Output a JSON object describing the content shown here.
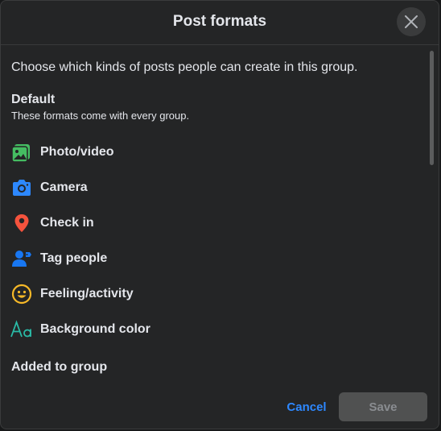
{
  "dialog": {
    "title": "Post formats",
    "intro": "Choose which kinds of posts people can create in this group.",
    "default_section": {
      "title": "Default",
      "subtitle": "These formats come with every group.",
      "formats": [
        {
          "label": "Photo/video",
          "icon": "photo-video-icon",
          "color": "#45bd62"
        },
        {
          "label": "Camera",
          "icon": "camera-icon",
          "color": "#2d88ff"
        },
        {
          "label": "Check in",
          "icon": "location-pin-icon",
          "color": "#f5533d"
        },
        {
          "label": "Tag people",
          "icon": "tag-people-icon",
          "color": "#1877f2"
        },
        {
          "label": "Feeling/activity",
          "icon": "smiley-icon",
          "color": "#f7b928"
        },
        {
          "label": "Background color",
          "icon": "text-aa-icon",
          "color": "#2abba7"
        }
      ]
    },
    "added_section": {
      "title": "Added to group"
    },
    "footer": {
      "cancel_label": "Cancel",
      "save_label": "Save"
    }
  },
  "colors": {
    "background": "#242526",
    "accent": "#2d88ff",
    "disabled_button": "#505151"
  }
}
